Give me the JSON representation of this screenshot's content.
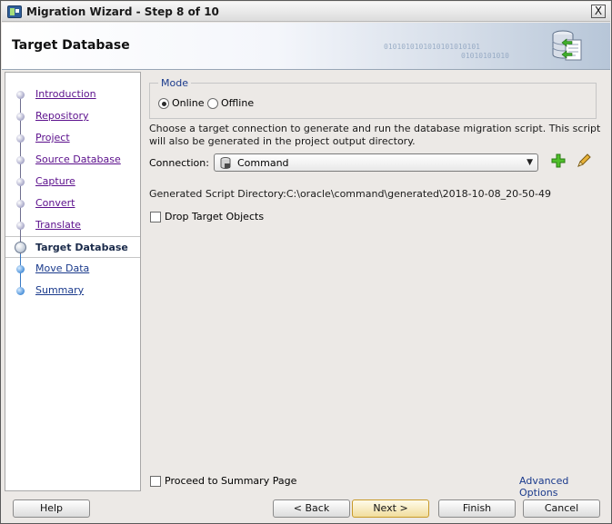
{
  "window": {
    "title": "Migration Wizard - Step 8 of 10",
    "close_label": "X"
  },
  "header": {
    "title": "Target Database",
    "binary_text_1": "0101010101010101010101",
    "binary_text_2": "01010101010"
  },
  "nav": {
    "items": [
      {
        "label": "Introduction",
        "state": "visited"
      },
      {
        "label": "Repository",
        "state": "visited"
      },
      {
        "label": "Project",
        "state": "visited"
      },
      {
        "label": "Source Database",
        "state": "visited"
      },
      {
        "label": "Capture",
        "state": "visited"
      },
      {
        "label": "Convert",
        "state": "visited"
      },
      {
        "label": "Translate",
        "state": "visited"
      },
      {
        "label": "Target Database",
        "state": "active"
      },
      {
        "label": "Move Data",
        "state": "future"
      },
      {
        "label": "Summary",
        "state": "future"
      }
    ]
  },
  "mode": {
    "legend": "Mode",
    "online_label": "Online",
    "offline_label": "Offline",
    "selected": "Online"
  },
  "description": "Choose a target connection to generate and run the database migration script.  This script will also be generated in the project output directory.",
  "connection": {
    "label": "Connection:",
    "value": "Command",
    "add_icon": "add-icon",
    "edit_icon": "pencil-icon"
  },
  "generated_dir": "Generated Script Directory:C:\\oracle\\command\\generated\\2018-10-08_20-50-49",
  "drop_target": {
    "label": "Drop Target Objects",
    "checked": false
  },
  "proceed_summary": {
    "label": "Proceed to Summary Page",
    "checked": false
  },
  "advanced_options_label": "Advanced Options",
  "buttons": {
    "help": "Help",
    "back": "< Back",
    "next": "Next >",
    "finish": "Finish",
    "cancel": "Cancel"
  },
  "colors": {
    "link_visited": "#5b0f8c",
    "link_future": "#1a3a8c",
    "default_button": "#f1dd9d"
  }
}
